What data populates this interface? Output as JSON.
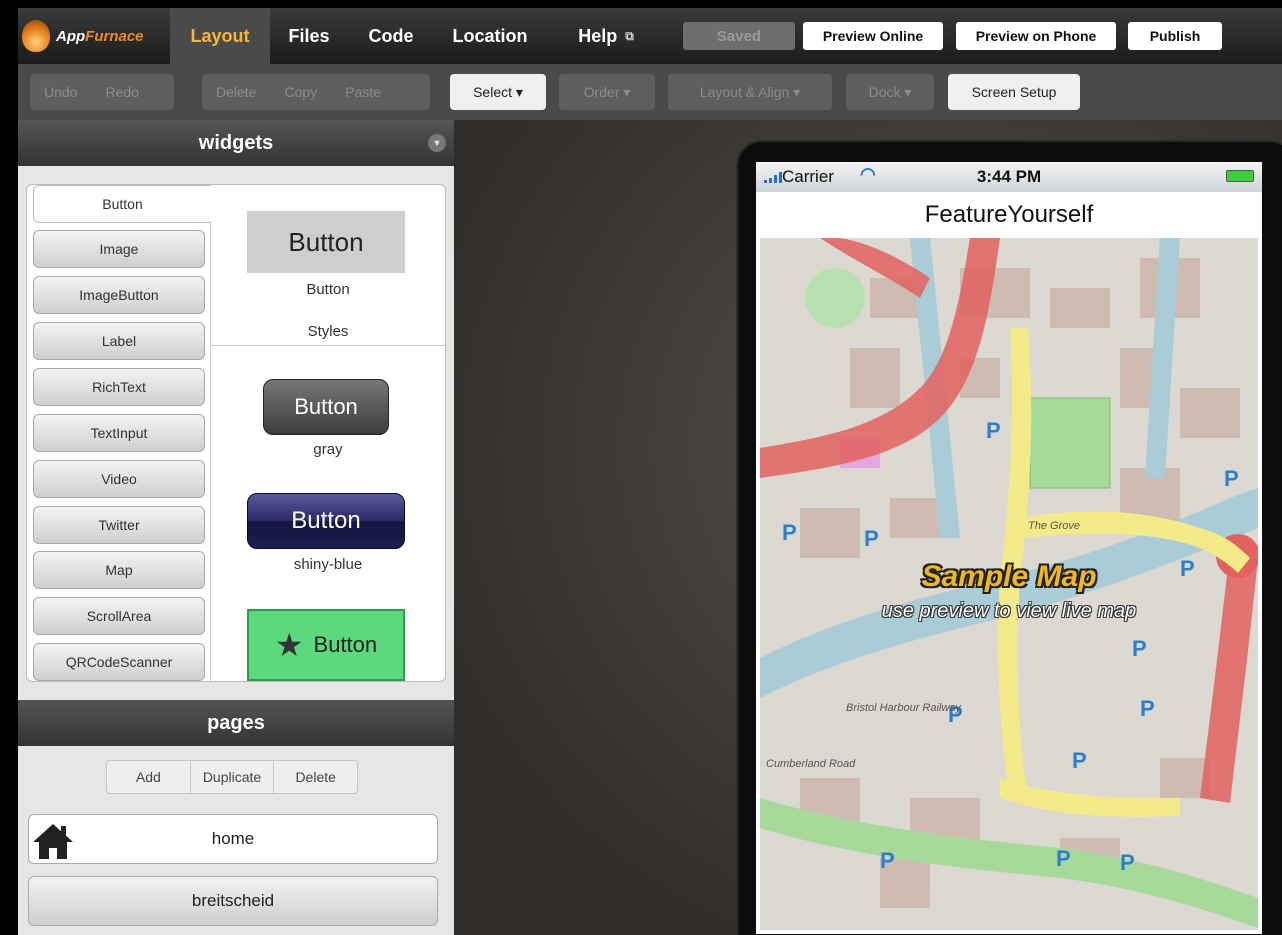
{
  "app": {
    "logo_prefix": "App",
    "logo_suffix": "Furnace"
  },
  "nav": {
    "tabs": [
      {
        "label": "Layout"
      },
      {
        "label": "Files"
      },
      {
        "label": "Code"
      },
      {
        "label": "Location"
      },
      {
        "label": "Help"
      }
    ],
    "saved_label": "Saved",
    "preview_online": "Preview Online",
    "preview_phone": "Preview on Phone",
    "publish": "Publish"
  },
  "toolbar": {
    "undo": "Undo",
    "redo": "Redo",
    "delete": "Delete",
    "copy": "Copy",
    "paste": "Paste",
    "select": "Select ▾",
    "order": "Order ▾",
    "layout_align": "Layout & Align ▾",
    "dock": "Dock ▾",
    "screen_setup": "Screen Setup"
  },
  "widgets": {
    "heading": "widgets",
    "items": [
      "Button",
      "Image",
      "ImageButton",
      "Label",
      "RichText",
      "TextInput",
      "Video",
      "Twitter",
      "Map",
      "ScrollArea",
      "QRCodeScanner"
    ],
    "preview": {
      "plain_label": "Button",
      "plain_caption": "Button",
      "styles_caption": "Styles",
      "gray_label": "Button",
      "gray_caption": "gray",
      "blue_label": "Button",
      "blue_caption": "shiny-blue",
      "green_label": "Button"
    }
  },
  "pages": {
    "heading": "pages",
    "add": "Add",
    "duplicate": "Duplicate",
    "delete": "Delete",
    "items": [
      "home",
      "breitscheid"
    ]
  },
  "phone": {
    "carrier": "Carrier",
    "time": "3:44 PM",
    "title": "FeatureYourself",
    "map_title": "Sample Map",
    "map_subtitle": "use preview to view live map",
    "street_labels": [
      "The Grove",
      "Cumberland Road",
      "Bristol Harbour Railway"
    ],
    "parking_symbol": "P"
  },
  "colors": {
    "active_tab": "#f4b73a",
    "accent_orange": "#f08a25",
    "green_button": "#5cd97d",
    "blue_button": "#1d1d52",
    "map_road_red": "#e2625f",
    "map_road_yellow": "#f3eb8a",
    "map_water": "#a9ccd6",
    "map_park": "#a6d99a"
  }
}
